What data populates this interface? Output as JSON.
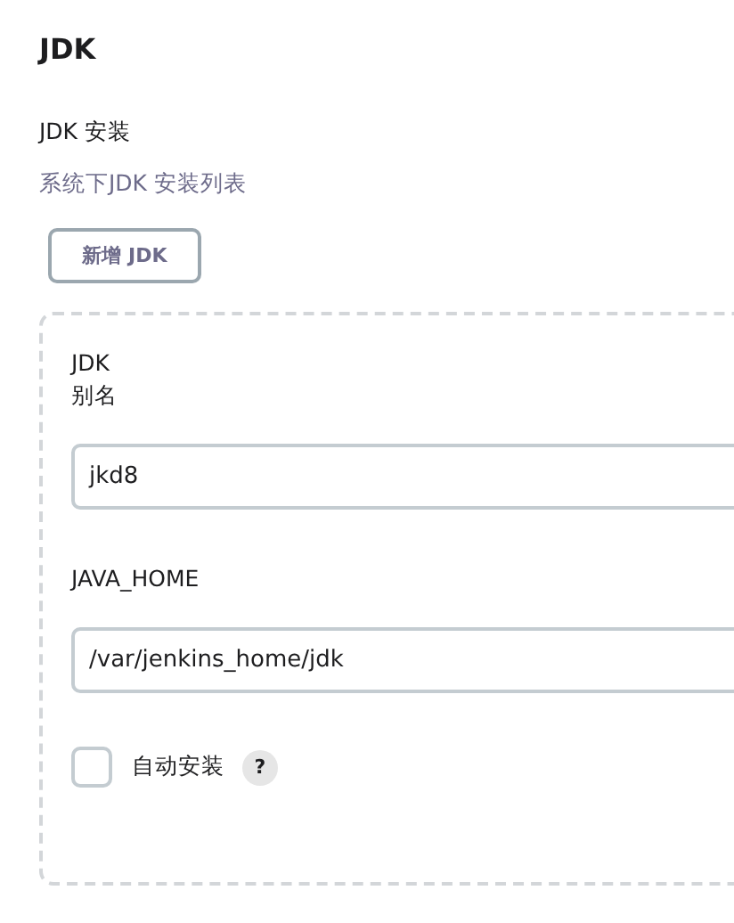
{
  "section_title": "JDK",
  "installations": {
    "label": "JDK 安装",
    "description": "系统下JDK 安装列表",
    "add_button": "新增 JDK"
  },
  "jdk": {
    "name_label_lines": [
      "JDK",
      "别名"
    ],
    "name_value": "jkd8",
    "home_label": "JAVA_HOME",
    "home_value": "/var/jenkins_home/jdk",
    "auto_install": {
      "label": "自动安装",
      "checked": false,
      "help": "?"
    }
  }
}
